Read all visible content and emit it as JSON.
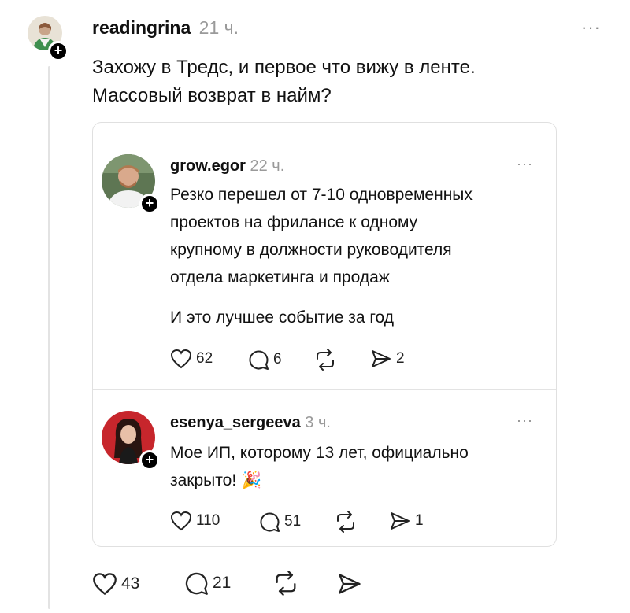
{
  "main_post": {
    "username": "readingrina",
    "time": "21 ч.",
    "more": "···",
    "text_line1": "Захожу в Тредс, и первое что вижу в ленте.",
    "text_line2": "Массовый возврат в найм?",
    "likes": "43",
    "replies": "21"
  },
  "quoted_posts": [
    {
      "username": "grow.egor",
      "time": "22 ч.",
      "more": "···",
      "lines": [
        "Резко перешел от 7-10 одновременных",
        "проектов на фрилансе к одному",
        "крупному в должности руководителя",
        "отдела маркетинга и продаж"
      ],
      "extra_line": "И это лучшее событие за год",
      "likes": "62",
      "replies": "6",
      "shares": "2"
    },
    {
      "username": "esenya_sergeeva",
      "time": "3 ч.",
      "more": "···",
      "lines": [
        "Мое ИП, которому 13 лет, официально",
        "закрыто! 🎉"
      ],
      "likes": "110",
      "replies": "51",
      "shares": "1"
    }
  ],
  "icons": [
    "heart-icon",
    "comment-icon",
    "repost-icon",
    "share-icon",
    "follow-plus-icon",
    "more-icon"
  ],
  "colors": {
    "text": "#111111",
    "muted": "#9a9a9a",
    "border": "#e0e0e0",
    "background": "#ffffff"
  }
}
